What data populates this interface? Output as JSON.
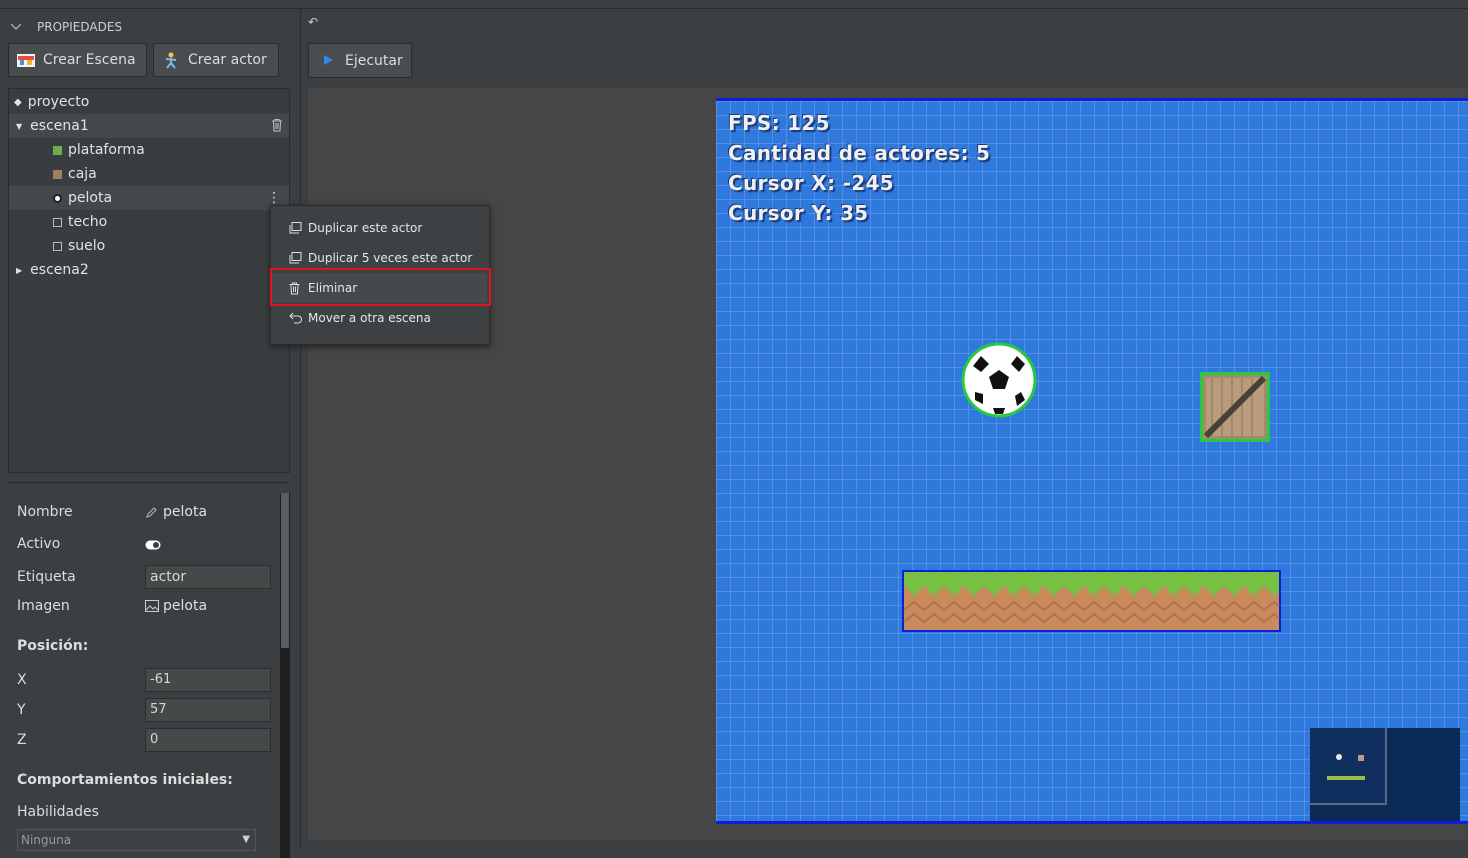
{
  "panel": {
    "title": "PROPIEDADES",
    "buttons": {
      "create_scene": "Crear Escena",
      "create_actor": "Crear actor"
    }
  },
  "tree": {
    "project": "proyecto",
    "scene1": "escena1",
    "actors": [
      {
        "label": "plataforma",
        "icon": "green-square-icon"
      },
      {
        "label": "caja",
        "icon": "crate-thumb-icon"
      },
      {
        "label": "pelota",
        "icon": "ball-thumb-icon"
      },
      {
        "label": "techo",
        "icon": "empty-square-icon"
      },
      {
        "label": "suelo",
        "icon": "empty-square-icon"
      }
    ],
    "scene2": "escena2"
  },
  "context_menu": {
    "items": [
      {
        "label": "Duplicar este actor",
        "icon": "copy-icon"
      },
      {
        "label": "Duplicar 5 veces este actor",
        "icon": "copy-icon"
      },
      {
        "label": "Eliminar",
        "icon": "trash-icon"
      },
      {
        "label": "Mover a otra escena",
        "icon": "move-icon"
      }
    ],
    "highlighted": "Eliminar",
    "highlight_color": "#e0141c"
  },
  "properties": {
    "name_label": "Nombre",
    "name_value": "pelota",
    "active_label": "Activo",
    "tag_label": "Etiqueta",
    "tag_value": "actor",
    "image_label": "Imagen",
    "image_value": "pelota",
    "position_title": "Posición:",
    "x_label": "X",
    "x_value": "-61",
    "y_label": "Y",
    "y_value": "57",
    "z_label": "Z",
    "z_value": "0",
    "behaviors_title": "Comportamientos iniciales:",
    "skills_label": "Habilidades",
    "skills_value": "Ninguna"
  },
  "toolbar": {
    "run_label": "Ejecutar",
    "undo_icon": "undo-icon"
  },
  "game": {
    "fps": "FPS: 125",
    "actor_count": "Cantidad de actores: 5",
    "cursor_x": "Cursor X: -245",
    "cursor_y": "Cursor Y: 35",
    "background_color": "#2f79dc",
    "border_color": "#0e1fd8"
  }
}
